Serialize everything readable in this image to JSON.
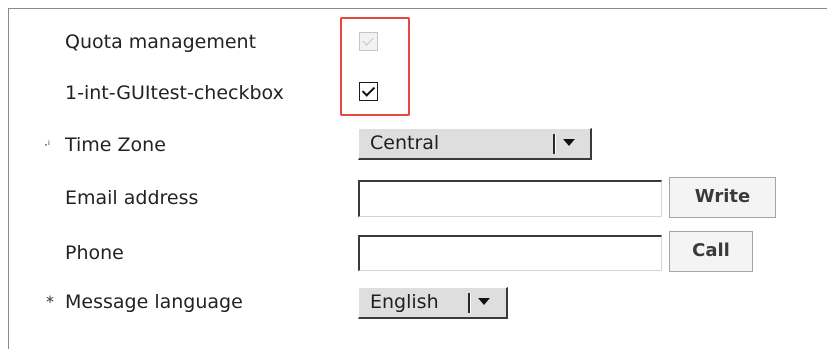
{
  "form": {
    "quota": {
      "label": "Quota management",
      "checked": true,
      "disabled": true
    },
    "gui_checkbox": {
      "label": "1-int-GUItest-checkbox",
      "checked": true
    },
    "timezone": {
      "marker": "·ⁱ",
      "label": "Time Zone",
      "selected": "Central"
    },
    "email": {
      "label": "Email address",
      "value": "",
      "button_label": "Write"
    },
    "phone": {
      "label": "Phone",
      "value": "",
      "button_label": "Call"
    },
    "language": {
      "marker": "*",
      "label": "Message language",
      "selected": "English"
    }
  },
  "colors": {
    "highlight": "#e8473f",
    "select_bg": "#dedede"
  },
  "icons": {
    "checkbox_mark": "check-icon",
    "dropdown": "triangle-down-icon"
  }
}
